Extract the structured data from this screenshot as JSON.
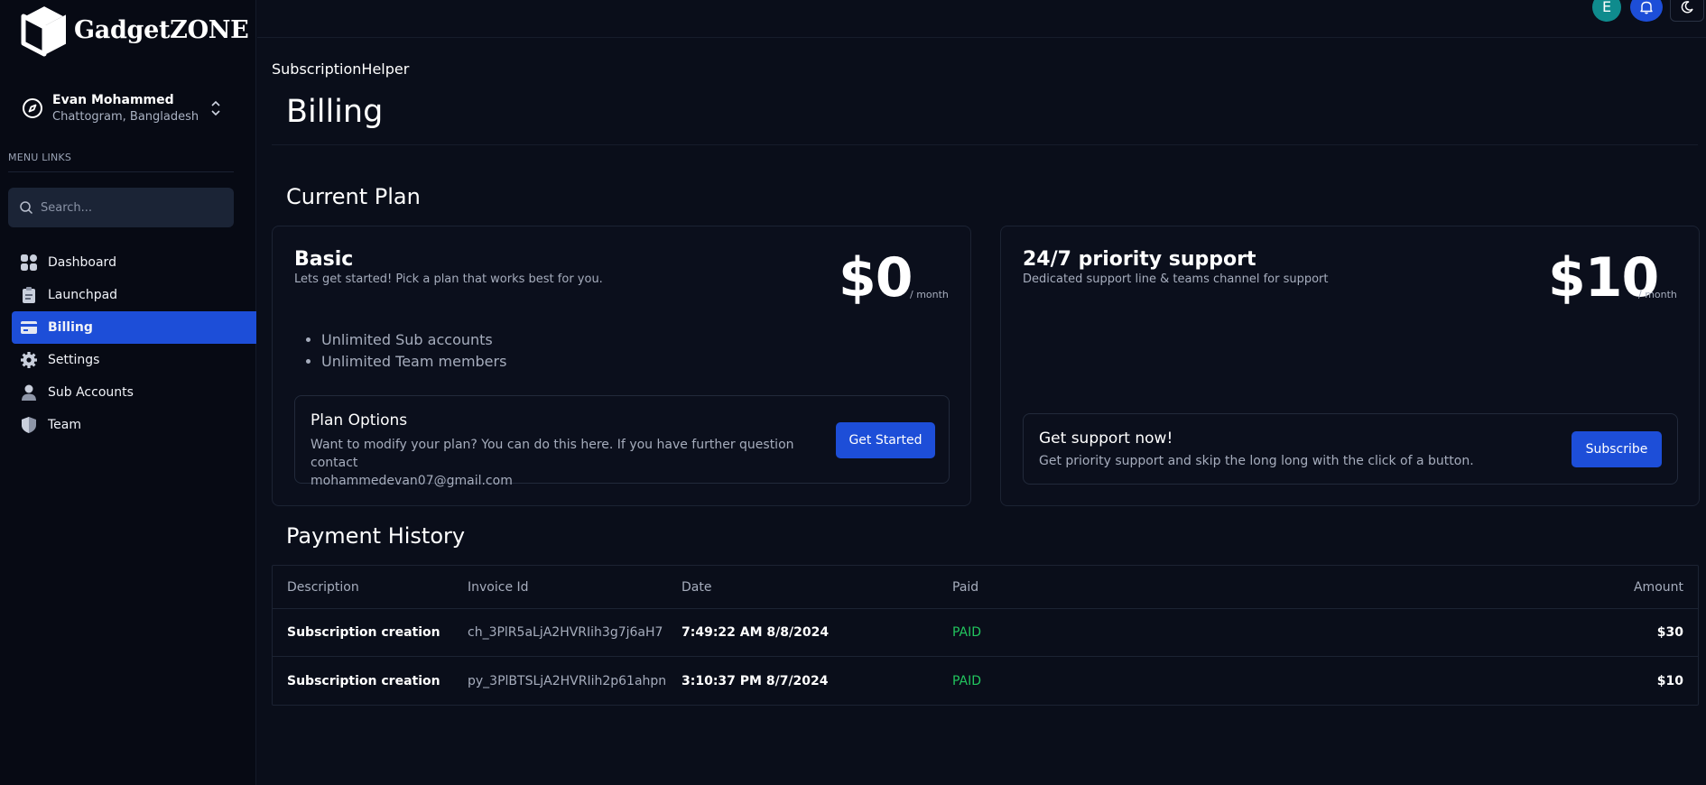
{
  "brand": {
    "name": "GadgetZONE"
  },
  "profile": {
    "name": "Evan Mohammed",
    "location": "Chattogram, Bangladesh"
  },
  "sidebar": {
    "caption": "MENU LINKS",
    "search_placeholder": "Search...",
    "items": [
      {
        "label": "Dashboard",
        "icon": "dashboard-icon"
      },
      {
        "label": "Launchpad",
        "icon": "clipboard-icon"
      },
      {
        "label": "Billing",
        "icon": "credit-card-icon",
        "active": true
      },
      {
        "label": "Settings",
        "icon": "gear-icon"
      },
      {
        "label": "Sub Accounts",
        "icon": "person-icon"
      },
      {
        "label": "Team",
        "icon": "shield-icon"
      }
    ]
  },
  "topbar": {
    "avatar_letter": "E"
  },
  "breadcrumb": "SubscriptionHelper",
  "page_title": "Billing",
  "current_plan": {
    "section_title": "Current Plan",
    "plan": {
      "name": "Basic",
      "description": "Lets get started! Pick a plan that works best for you.",
      "price": "$0",
      "period": "/ month",
      "features": [
        "Unlimited Sub accounts",
        "Unlimited Team members"
      ],
      "options_title": "Plan Options",
      "options_desc_line1": "Want to modify your plan? You can do this here. If you have further question contact",
      "options_desc_line2": "mohammedevan07@gmail.com",
      "button": "Get Started"
    },
    "addon": {
      "name": "24/7 priority support",
      "description": "Dedicated support line & teams channel for support",
      "price": "$10",
      "period": "/ month",
      "cta_title": "Get support now!",
      "cta_desc": "Get priority support and skip the long long with the click of a button.",
      "button": "Subscribe"
    }
  },
  "payment_history": {
    "section_title": "Payment History",
    "columns": [
      "Description",
      "Invoice Id",
      "Date",
      "Paid",
      "Amount"
    ],
    "rows": [
      {
        "description": "Subscription creation",
        "invoice_id": "ch_3PlR5aLjA2HVRIih3g7j6aH7",
        "date": "7:49:22 AM 8/8/2024",
        "paid": "PAID",
        "amount": "$30"
      },
      {
        "description": "Subscription creation",
        "invoice_id": "py_3PlBTSLjA2HVRIih2p61ahpn",
        "date": "3:10:37 PM 8/7/2024",
        "paid": "PAID",
        "amount": "$10"
      }
    ]
  },
  "colors": {
    "accent": "#1d4ed8",
    "background": "#0a0e1a",
    "paid": "#22c55e",
    "avatar": "#0f8b8d"
  }
}
